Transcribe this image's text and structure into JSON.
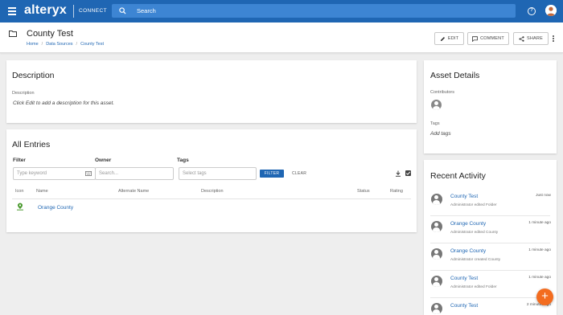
{
  "topbar": {
    "logo": "alteryx",
    "product": "CONNECT",
    "search_placeholder": "Search",
    "help_glyph": "?"
  },
  "header": {
    "title": "County Test",
    "breadcrumb": [
      "Home",
      "Data Sources",
      "County Test"
    ],
    "buttons": {
      "edit": "EDIT",
      "comment": "COMMENT",
      "share": "SHARE"
    }
  },
  "description": {
    "title": "Description",
    "label": "Description",
    "placeholder_text": "Click Edit to add a description for this asset."
  },
  "entries": {
    "title": "All Entries",
    "filter_label": "Filter",
    "filter_placeholder": "Type keyword",
    "owner_label": "Owner",
    "owner_placeholder": "Search...",
    "tags_label": "Tags",
    "tags_placeholder": "Select tags",
    "filter_button": "FILTER",
    "clear_button": "CLEAR",
    "columns": [
      "Icon",
      "Name",
      "Alternate Name",
      "Description",
      "Status",
      "Rating"
    ],
    "rows": [
      {
        "icon": "map-pin-icon",
        "name": "Orange County"
      }
    ]
  },
  "asset_details": {
    "title": "Asset Details",
    "contributors_label": "Contributors",
    "tags_label": "Tags",
    "tags_text": "Add tags"
  },
  "recent_activity": {
    "title": "Recent Activity",
    "items": [
      {
        "title": "County Test",
        "sub": "Administrator edited Folder",
        "time": "Just now"
      },
      {
        "title": "Orange County",
        "sub": "Administrator edited County",
        "time": "1 minute ago"
      },
      {
        "title": "Orange County",
        "sub": "Administrator created County",
        "time": "1 minute ago"
      },
      {
        "title": "County Test",
        "sub": "Administrator edited Folder",
        "time": "1 minute ago"
      },
      {
        "title": "County Test",
        "sub": "",
        "time": "2 minutes ago"
      }
    ]
  },
  "fab": {
    "label": "+"
  },
  "colors": {
    "brand": "#1f66b3",
    "fab": "#f36c1f",
    "background": "#eeeeee"
  }
}
